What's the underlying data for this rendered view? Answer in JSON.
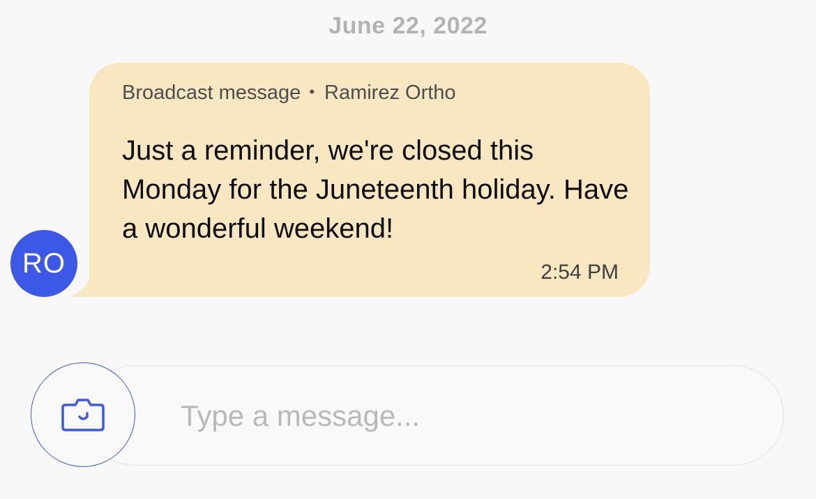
{
  "date_header": "June 22, 2022",
  "message": {
    "type_label": "Broadcast message",
    "separator": "•",
    "sender": "Ramirez Ortho",
    "text": "Just a reminder, we're closed this Monday for the Juneteenth holiday. Have a wonderful weekend!",
    "time": "2:54 PM",
    "bubble_color": "#f8e7c1"
  },
  "avatar": {
    "initials": "RO",
    "color": "#3b58e6"
  },
  "composer": {
    "placeholder": "Type a message...",
    "camera_icon": "camera-icon",
    "accent_color": "#3b58e6"
  }
}
